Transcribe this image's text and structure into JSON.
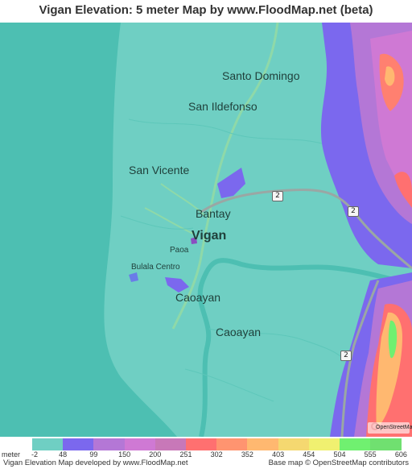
{
  "title": "Vigan Elevation: 5 meter Map by www.FloodMap.net (beta)",
  "places": {
    "santo_domingo": "Santo Domingo",
    "san_ildefonso": "San Ildefonso",
    "san_vicente": "San Vicente",
    "bantay": "Bantay",
    "vigan": "Vigan",
    "paoa": "Paoa",
    "bulala_centro": "Bulala Centro",
    "caoayan_1": "Caoayan",
    "caoayan_2": "Caoayan"
  },
  "road_shields": [
    "2",
    "2",
    "2"
  ],
  "osm_logo": "OpenStreetMap",
  "legend": {
    "unit": "meter",
    "ticks": [
      "-2",
      "48",
      "99",
      "150",
      "200",
      "251",
      "302",
      "352",
      "403",
      "454",
      "504",
      "555",
      "606"
    ],
    "colors": [
      "#6fcfc3",
      "#7b68ee",
      "#b477d6",
      "#cf79d4",
      "#c878b8",
      "#ff7070",
      "#ff9470",
      "#ffb870",
      "#f5d870",
      "#f0f070",
      "#70f070",
      "#70e070"
    ]
  },
  "footer": {
    "left": "Vigan Elevation Map developed by www.FloodMap.net",
    "right": "Base map © OpenStreetMap contributors"
  }
}
